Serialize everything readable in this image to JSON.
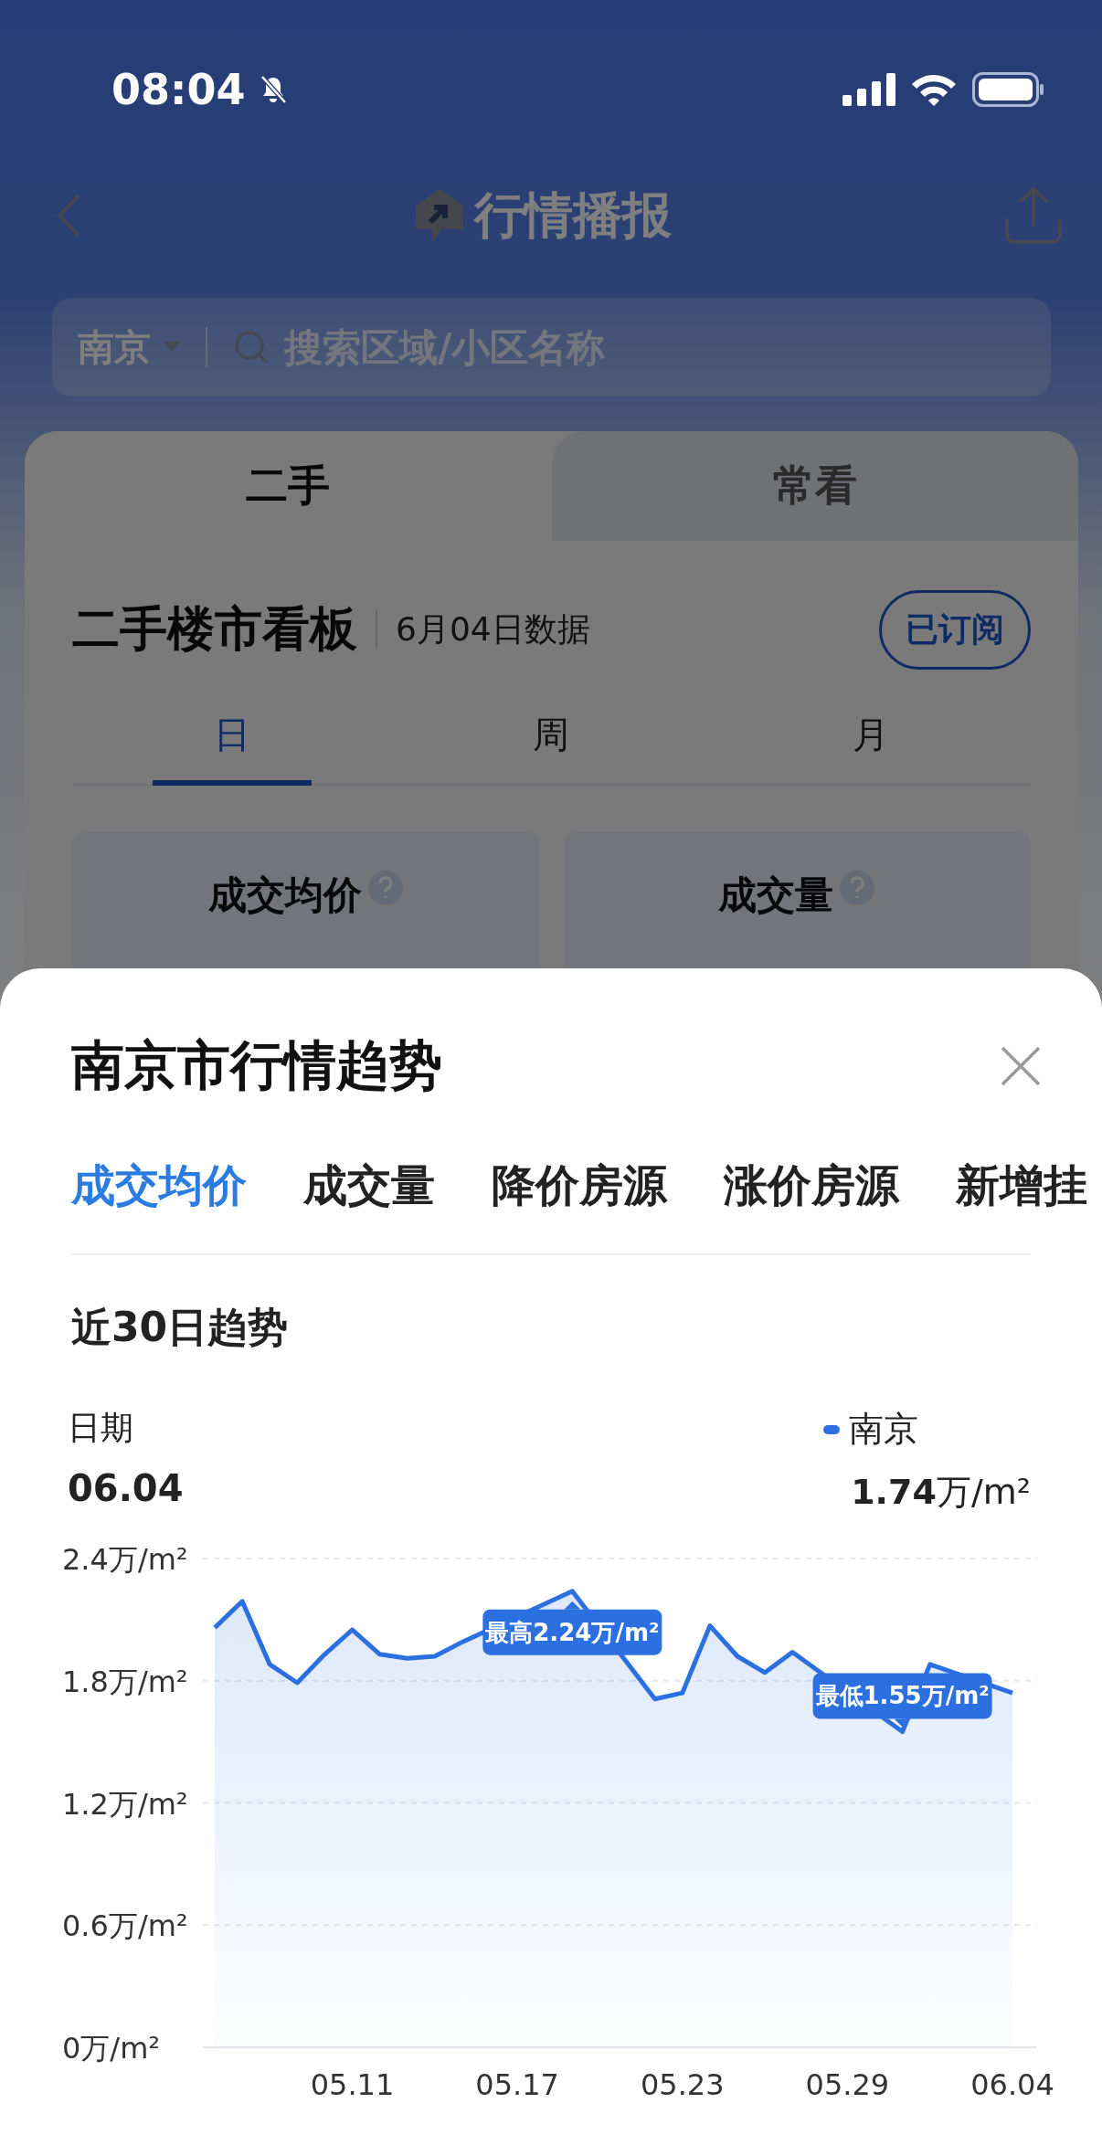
{
  "status_bar": {
    "time": "08:04"
  },
  "nav": {
    "title": "行情播报"
  },
  "search": {
    "city": "南京",
    "placeholder": "搜索区域/小区名称"
  },
  "board": {
    "tabs": [
      {
        "label": "二手",
        "selected": true
      },
      {
        "label": "常看",
        "selected": false
      }
    ],
    "title": "二手楼市看板",
    "date": "6月04日数据",
    "subscribe_button": "已订阅",
    "periods": [
      {
        "label": "日",
        "selected": true
      },
      {
        "label": "周",
        "selected": false
      },
      {
        "label": "月",
        "selected": false
      }
    ],
    "stats": [
      {
        "label": "成交均价"
      },
      {
        "label": "成交量"
      }
    ]
  },
  "sheet": {
    "title": "南京市行情趋势",
    "tabs": [
      {
        "label": "成交均价",
        "selected": true
      },
      {
        "label": "成交量",
        "selected": false
      },
      {
        "label": "降价房源",
        "selected": false
      },
      {
        "label": "涨价房源",
        "selected": false
      },
      {
        "label": "新增挂",
        "selected": false
      }
    ],
    "section_title": "近30日趋势",
    "date_label": "日期",
    "date_value": "06.04",
    "legend": {
      "value": "**1.74**万/m²"
    },
    "chart_data": {
      "type": "line",
      "grid": true,
      "categories": [
        null,
        null,
        null,
        null,
        null,
        "05.11",
        null,
        null,
        null,
        null,
        null,
        "05.17",
        null,
        null,
        null,
        null,
        null,
        "05.23",
        null,
        null,
        null,
        null,
        null,
        "05.29",
        null,
        null,
        null,
        null,
        null,
        "06.04"
      ],
      "series": [
        {
          "name": "南京",
          "color": "#2b6fe0",
          "values": [
            2.06,
            2.19,
            1.88,
            1.79,
            1.93,
            2.05,
            1.93,
            1.91,
            1.92,
            1.99,
            null,
            null,
            null,
            2.24,
            null,
            null,
            1.71,
            1.74,
            2.07,
            1.92,
            1.84,
            1.94,
            null,
            null,
            null,
            1.55,
            1.88,
            null,
            null,
            1.74
          ]
        }
      ],
      "ylim": [
        0,
        2.4
      ],
      "yticks": [
        {
          "value": 0,
          "label": "0万/m²"
        },
        {
          "value": 0.6,
          "label": "0.6万/m²"
        },
        {
          "value": 1.2,
          "label": "1.2万/m²"
        },
        {
          "value": 1.8,
          "label": "1.8万/m²"
        },
        {
          "value": 2.4,
          "label": "2.4万/m²"
        }
      ],
      "annotations": [
        {
          "y": 2.24,
          "text": "最高2.24万/m²"
        },
        {
          "y": 1.55,
          "text": "最低1.55万/m²"
        }
      ]
    }
  }
}
